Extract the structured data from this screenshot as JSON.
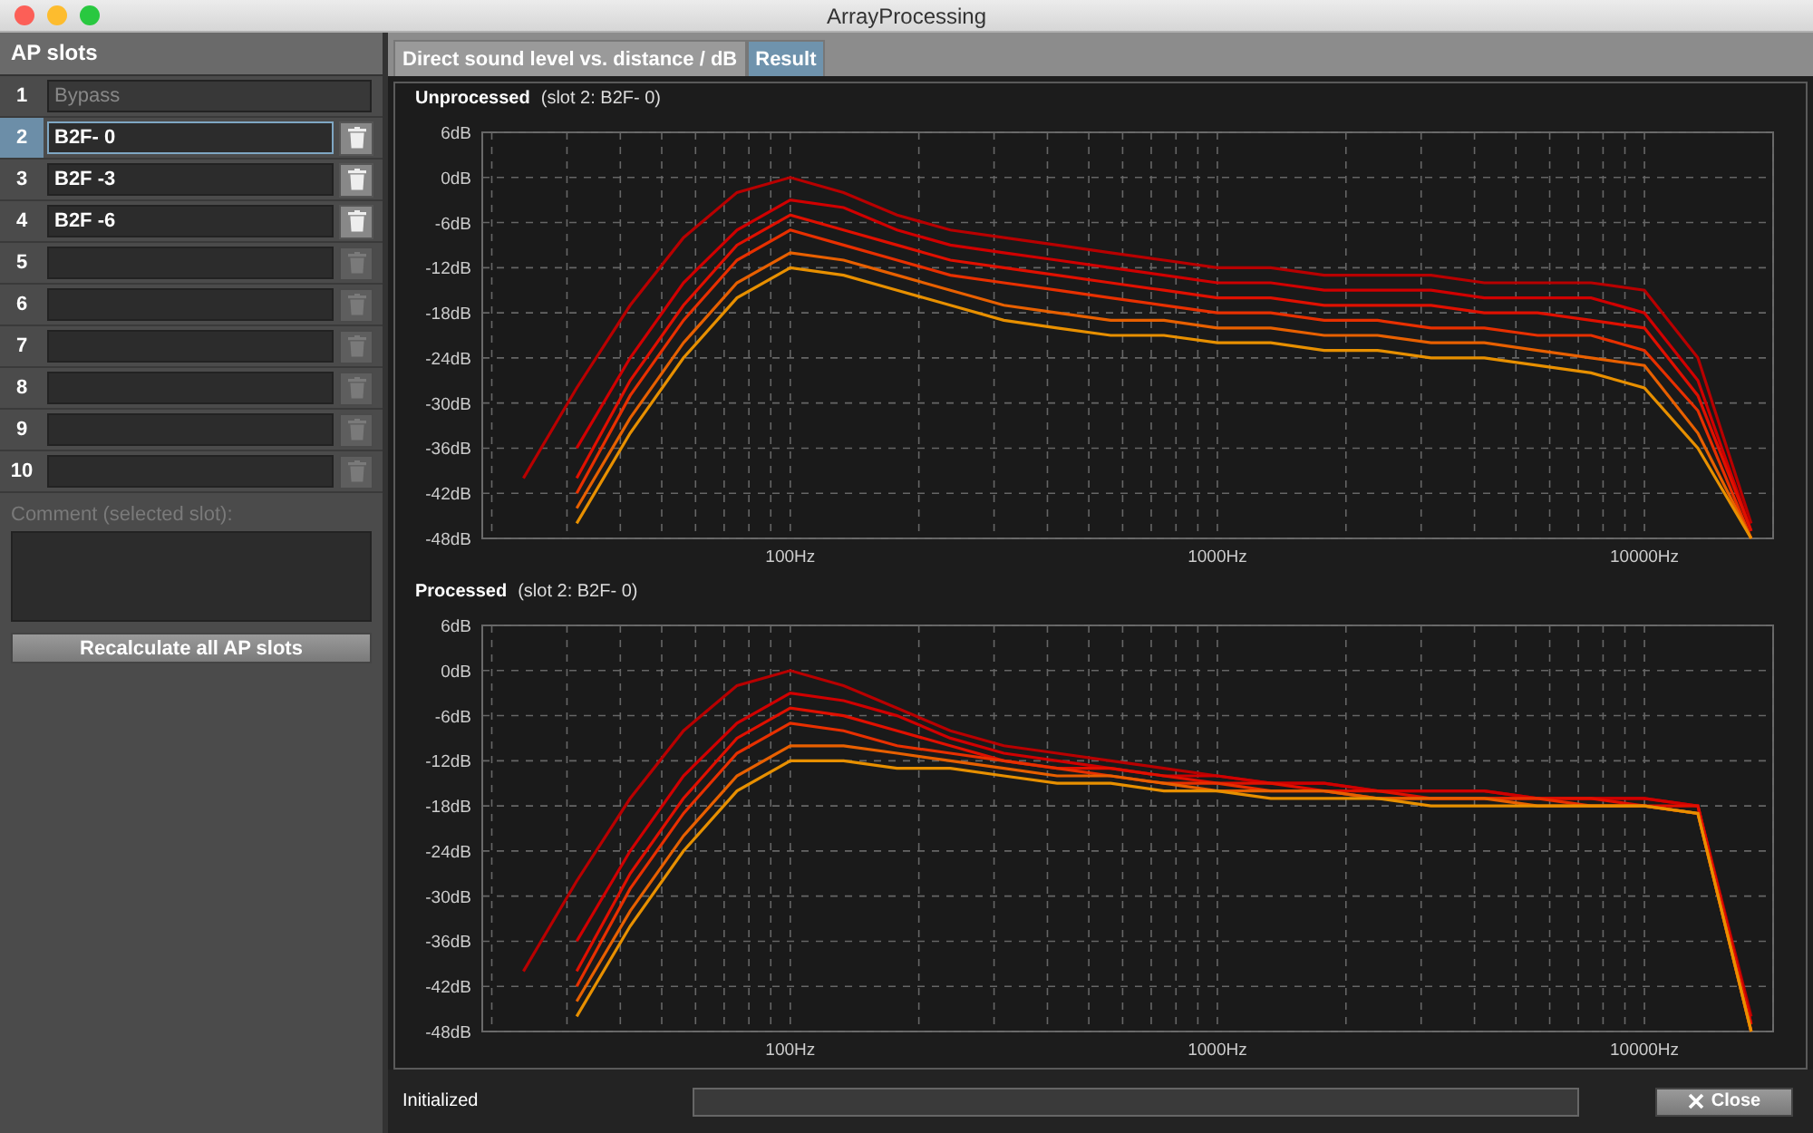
{
  "window": {
    "title": "ArrayProcessing"
  },
  "sidebar": {
    "title": "AP slots",
    "slots": [
      {
        "number": "1",
        "name": "Bypass",
        "selected": false,
        "disabled": true
      },
      {
        "number": "2",
        "name": "B2F- 0",
        "selected": true,
        "disabled": false,
        "delete_enabled": true
      },
      {
        "number": "3",
        "name": "B2F -3",
        "selected": false,
        "disabled": false,
        "delete_enabled": true
      },
      {
        "number": "4",
        "name": "B2F -6",
        "selected": false,
        "disabled": false,
        "delete_enabled": true
      },
      {
        "number": "5",
        "selected": false,
        "disabled": false,
        "delete_enabled": false
      },
      {
        "number": "6",
        "selected": false,
        "disabled": false,
        "delete_enabled": false
      },
      {
        "number": "7",
        "selected": false,
        "disabled": false,
        "delete_enabled": false
      },
      {
        "number": "8",
        "selected": false,
        "disabled": false,
        "delete_enabled": false
      },
      {
        "number": "9",
        "selected": false,
        "disabled": false,
        "delete_enabled": false
      },
      {
        "number": "10",
        "selected": false,
        "disabled": false,
        "delete_enabled": false
      }
    ],
    "comment_label": "Comment (selected slot):",
    "comment_disabled": true,
    "recalculate_button": "Recalculate all AP slots"
  },
  "tabs": [
    {
      "label": "Direct sound level vs. distance / dB",
      "selected": false
    },
    {
      "label": "Result",
      "selected": true
    }
  ],
  "charts": [
    {
      "title": "Unprocessed",
      "subtitle": "(slot 2: B2F- 0)",
      "chart_data": {
        "type": "line",
        "grid": true,
        "categories": [
          null,
          null,
          null,
          null,
          null,
          "100Hz",
          null,
          null,
          null,
          null,
          null,
          null,
          null,
          "1000Hz",
          null,
          null,
          null,
          null,
          null,
          null,
          null,
          "10000Hz",
          null,
          null
        ],
        "ylim": [
          -48,
          6
        ],
        "yticks": [
          {
            "value": 6,
            "label": "6dB"
          },
          {
            "value": 0,
            "label": "0dB"
          },
          {
            "value": -6,
            "label": "-6dB"
          },
          {
            "value": -12,
            "label": "-12dB"
          },
          {
            "value": -18,
            "label": "-18dB"
          },
          {
            "value": -24,
            "label": "-24dB"
          },
          {
            "value": -30,
            "label": "-30dB"
          },
          {
            "value": -36,
            "label": "-36dB"
          },
          {
            "value": -42,
            "label": "-42dB"
          },
          {
            "value": -48,
            "label": "-48dB"
          }
        ],
        "series": [
          {
            "color": "#b80000",
            "values": [
              -40,
              -28,
              -17,
              -8,
              -2,
              0,
              -2,
              -5,
              -7,
              -8,
              -9,
              -10,
              -11,
              -12,
              -12,
              -13,
              -13,
              -13,
              -14,
              -14,
              -14,
              -15,
              -24,
              -46
            ]
          },
          {
            "color": "#d00000",
            "values": [
              null,
              -36,
              -24,
              -14,
              -7,
              -3,
              -4,
              -7,
              -9,
              -10,
              -11,
              -12,
              -13,
              -14,
              -14,
              -15,
              -15,
              -15,
              -16,
              -16,
              -16,
              -18,
              -27,
              -47
            ]
          },
          {
            "color": "#e01000",
            "values": [
              null,
              -40,
              -27,
              -17,
              -9,
              -5,
              -7,
              -9,
              -11,
              -12,
              -13,
              -14,
              -15,
              -16,
              -16,
              -17,
              -17,
              -17,
              -18,
              -18,
              -19,
              -20,
              -29,
              -47
            ]
          },
          {
            "color": "#e83000",
            "values": [
              null,
              -42,
              -29,
              -19,
              -11,
              -7,
              -9,
              -11,
              -13,
              -14,
              -15,
              -16,
              -17,
              -18,
              -18,
              -19,
              -19,
              -20,
              -20,
              -21,
              -21,
              -23,
              -31,
              -48
            ]
          },
          {
            "color": "#e86000",
            "values": [
              null,
              -44,
              -32,
              -22,
              -14,
              -10,
              -11,
              -13,
              -15,
              -17,
              -18,
              -19,
              -19,
              -20,
              -20,
              -21,
              -21,
              -22,
              -22,
              -23,
              -24,
              -25,
              -34,
              -48
            ]
          },
          {
            "color": "#e89000",
            "values": [
              null,
              -46,
              -34,
              -24,
              -16,
              -12,
              -13,
              -15,
              -17,
              -19,
              -20,
              -21,
              -21,
              -22,
              -22,
              -23,
              -23,
              -24,
              -24,
              -25,
              -26,
              -28,
              -36,
              -48
            ]
          }
        ]
      }
    },
    {
      "title": "Processed",
      "subtitle": "(slot 2: B2F- 0)",
      "chart_data": {
        "type": "line",
        "grid": true,
        "categories": [
          null,
          null,
          null,
          null,
          null,
          "100Hz",
          null,
          null,
          null,
          null,
          null,
          null,
          null,
          "1000Hz",
          null,
          null,
          null,
          null,
          null,
          null,
          null,
          "10000Hz",
          null,
          null
        ],
        "ylim": [
          -48,
          6
        ],
        "yticks": [
          {
            "value": 6,
            "label": "6dB"
          },
          {
            "value": 0,
            "label": "0dB"
          },
          {
            "value": -6,
            "label": "-6dB"
          },
          {
            "value": -12,
            "label": "-12dB"
          },
          {
            "value": -18,
            "label": "-18dB"
          },
          {
            "value": -24,
            "label": "-24dB"
          },
          {
            "value": -30,
            "label": "-30dB"
          },
          {
            "value": -36,
            "label": "-36dB"
          },
          {
            "value": -42,
            "label": "-42dB"
          },
          {
            "value": -48,
            "label": "-48dB"
          }
        ],
        "series": [
          {
            "color": "#b80000",
            "values": [
              -40,
              -28,
              -17,
              -8,
              -2,
              0,
              -2,
              -5,
              -8,
              -10,
              -11,
              -12,
              -13,
              -14,
              -15,
              -15,
              -16,
              -16,
              -16,
              -17,
              -17,
              -17,
              -18,
              -46
            ]
          },
          {
            "color": "#d00000",
            "values": [
              null,
              -36,
              -24,
              -14,
              -7,
              -3,
              -4,
              -6,
              -9,
              -11,
              -12,
              -13,
              -14,
              -14,
              -15,
              -15,
              -16,
              -16,
              -16,
              -17,
              -17,
              -17,
              -18,
              -47
            ]
          },
          {
            "color": "#e01000",
            "values": [
              null,
              -40,
              -27,
              -17,
              -9,
              -5,
              -6,
              -8,
              -10,
              -12,
              -13,
              -13,
              -14,
              -15,
              -15,
              -16,
              -16,
              -17,
              -17,
              -17,
              -17,
              -18,
              -18,
              -47
            ]
          },
          {
            "color": "#e83000",
            "values": [
              null,
              -42,
              -29,
              -19,
              -11,
              -7,
              -8,
              -10,
              -11,
              -12,
              -13,
              -14,
              -15,
              -15,
              -16,
              -16,
              -17,
              -17,
              -17,
              -17,
              -18,
              -18,
              -19,
              -48
            ]
          },
          {
            "color": "#e86000",
            "values": [
              null,
              -44,
              -32,
              -22,
              -14,
              -10,
              -10,
              -11,
              -12,
              -13,
              -14,
              -14,
              -15,
              -16,
              -16,
              -16,
              -17,
              -17,
              -17,
              -18,
              -18,
              -18,
              -19,
              -48
            ]
          },
          {
            "color": "#e89000",
            "values": [
              null,
              -46,
              -34,
              -24,
              -16,
              -12,
              -12,
              -13,
              -13,
              -14,
              -15,
              -15,
              -16,
              -16,
              -17,
              -17,
              -17,
              -18,
              -18,
              -18,
              -18,
              -18,
              -19,
              -48
            ]
          }
        ]
      }
    }
  ],
  "status": {
    "text": "Initialized",
    "progress": {
      "level": 0
    }
  },
  "close_button": "Close"
}
